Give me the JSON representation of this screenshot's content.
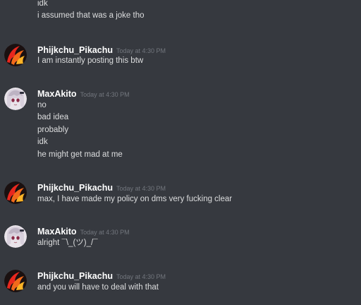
{
  "top_lines": [
    "idk",
    "i assumed that was a joke tho"
  ],
  "messages": [
    {
      "author": "Phijkchu_Pikachu",
      "timestamp": "Today at 4:30 PM",
      "lines": [
        "I am instantly posting this btw"
      ]
    },
    {
      "author": "MaxAkito",
      "timestamp": "Today at 4:30 PM",
      "lines": [
        "no",
        "bad idea",
        "probably",
        "idk",
        "he might get mad at me"
      ]
    },
    {
      "author": "Phijkchu_Pikachu",
      "timestamp": "Today at 4:30 PM",
      "lines": [
        "max, I have made my policy on dms very fucking clear"
      ]
    },
    {
      "author": "MaxAkito",
      "timestamp": "Today at 4:30 PM",
      "lines": [
        "alright ¯\\_(ツ)_/¯"
      ]
    },
    {
      "author": "Phijkchu_Pikachu",
      "timestamp": "Today at 4:30 PM",
      "lines": [
        "and you will have to deal with that"
      ]
    }
  ],
  "colors": {
    "background": "#36393f",
    "text": "#dcddde",
    "username": "#ffffff",
    "timestamp": "#72767d"
  },
  "icons": {
    "avatar_phijkchu": "fire-avatar-icon",
    "avatar_max": "anime-girl-avatar-icon"
  }
}
